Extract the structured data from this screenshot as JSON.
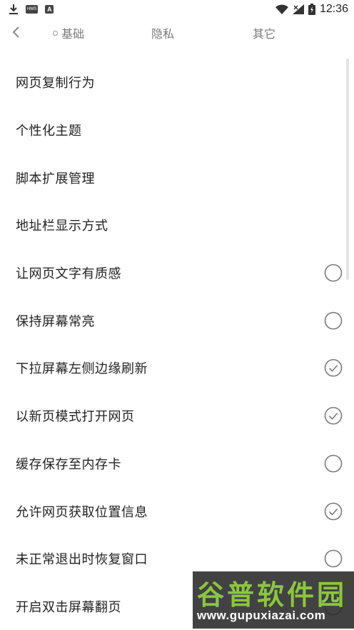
{
  "status_bar": {
    "time": "12:36",
    "badge_hms": "HMS",
    "badge_a": "A",
    "icons": [
      "download-icon",
      "hms-icon",
      "a-app-icon",
      "wifi-icon",
      "signal-off-icon",
      "battery-charging-icon"
    ]
  },
  "header": {
    "back_icon": "chevron-left-icon",
    "tabs": [
      {
        "label": "基础",
        "active": true
      },
      {
        "label": "隐私",
        "active": false
      },
      {
        "label": "其它",
        "active": false
      }
    ]
  },
  "settings": [
    {
      "label": "网页复制行为",
      "toggle": null
    },
    {
      "label": "个性化主题",
      "toggle": null
    },
    {
      "label": "脚本扩展管理",
      "toggle": null
    },
    {
      "label": "地址栏显示方式",
      "toggle": null
    },
    {
      "label": "让网页文字有质感",
      "toggle": false
    },
    {
      "label": "保持屏幕常亮",
      "toggle": false
    },
    {
      "label": "下拉屏幕左侧边缘刷新",
      "toggle": true
    },
    {
      "label": "以新页模式打开网页",
      "toggle": true
    },
    {
      "label": "缓存保存至内存卡",
      "toggle": false
    },
    {
      "label": "允许网页获取位置信息",
      "toggle": true
    },
    {
      "label": "未正常退出时恢复窗口",
      "toggle": false
    },
    {
      "label": "开启双击屏幕翻页",
      "toggle": false
    }
  ],
  "watermark": {
    "title": "谷普软件园",
    "url": "www.gupuxiazai.com"
  },
  "colors": {
    "text": "#222222",
    "tab_inactive": "#7a7a7a",
    "check_stroke": "#7a7a7a",
    "watermark_green": "#8cc63f"
  }
}
